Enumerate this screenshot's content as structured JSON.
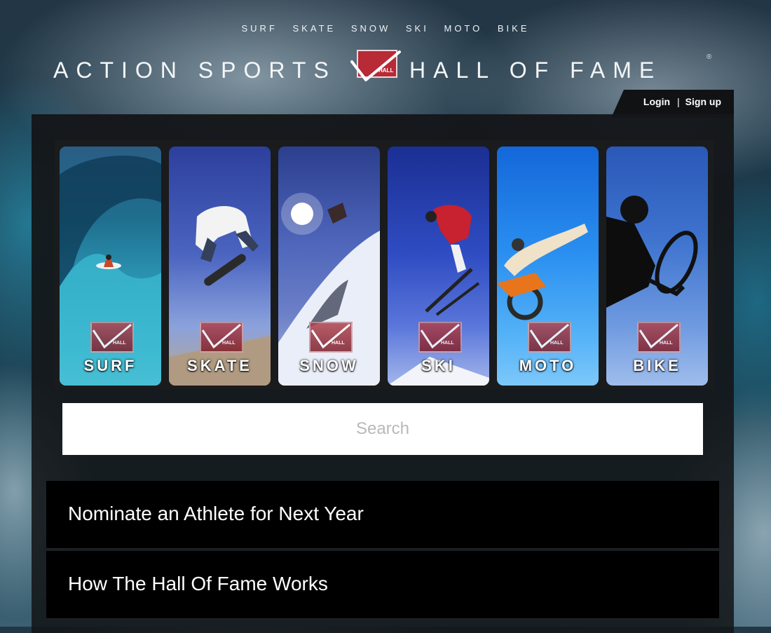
{
  "top_nav": [
    "SURF",
    "SKATE",
    "SNOW",
    "SKI",
    "MOTO",
    "BIKE"
  ],
  "brand": {
    "left": "ACTION SPORTS",
    "right": "HALL OF FAME",
    "registered": "®",
    "logo_text": "HALL"
  },
  "auth": {
    "login": "Login",
    "separator": "|",
    "signup": "Sign up"
  },
  "sports": [
    {
      "label": "SURF",
      "icon": "wave-surfer"
    },
    {
      "label": "SKATE",
      "icon": "skateboarder"
    },
    {
      "label": "SNOW",
      "icon": "snowboarder"
    },
    {
      "label": "SKI",
      "icon": "skier"
    },
    {
      "label": "MOTO",
      "icon": "motocross"
    },
    {
      "label": "BIKE",
      "icon": "bmx-rider"
    }
  ],
  "badge_text": "HALL",
  "search": {
    "placeholder": "Search",
    "value": ""
  },
  "menu": [
    {
      "label": "Nominate an Athlete for Next Year"
    },
    {
      "label": "How The Hall Of Fame Works"
    }
  ]
}
